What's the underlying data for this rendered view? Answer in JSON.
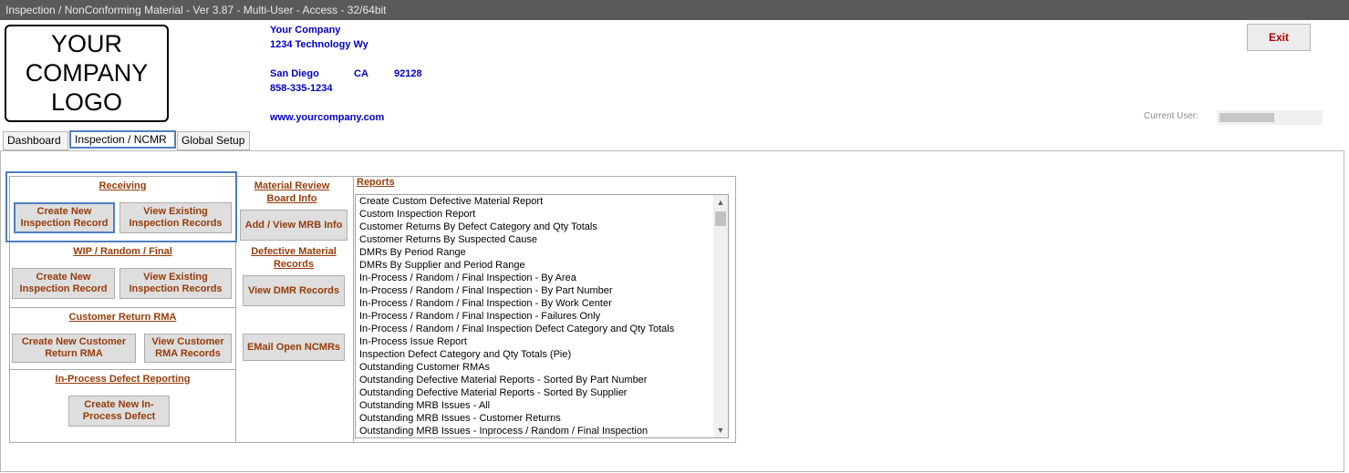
{
  "window": {
    "title": "Inspection / NonConforming Material - Ver 3.87 - Multi-User - Access - 32/64bit"
  },
  "logo": {
    "lines": [
      "YOUR",
      "COMPANY",
      "LOGO"
    ]
  },
  "company": {
    "name": "Your Company",
    "street": "1234 Technology Wy",
    "city": "San Diego",
    "state": "CA",
    "zip": "92128",
    "phone": "858-335-1234",
    "website": "www.yourcompany.com"
  },
  "exit_label": "Exit",
  "current_user": {
    "label": "Current User:",
    "value": ""
  },
  "tabs": [
    {
      "label": "Dashboard",
      "active": false
    },
    {
      "label": "Inspection / NCMR",
      "active": true
    },
    {
      "label": "Global Setup",
      "active": false
    }
  ],
  "receiving": {
    "title": "Receiving",
    "create_label": "Create New Inspection Record",
    "view_label": "View Existing Inspection Records"
  },
  "wip": {
    "title": "WIP / Random / Final",
    "create_label": "Create New Inspection Record",
    "view_label": "View Existing Inspection Records"
  },
  "rma": {
    "title": "Customer Return RMA",
    "create_label": "Create New Customer Return RMA",
    "view_label": "View Customer RMA Records"
  },
  "inprocess": {
    "title": "In-Process Defect Reporting",
    "create_label": "Create New In-Process Defect"
  },
  "mrb": {
    "title": "Material Review Board Info",
    "button_label": "Add / View MRB Info"
  },
  "defective": {
    "title": "Defective Material Records",
    "view_label": "View DMR Records",
    "email_label": "EMail Open NCMRs"
  },
  "reports": {
    "title": "Reports",
    "items": [
      "Create Custom Defective Material Report",
      "Custom Inspection Report",
      "Customer Returns By Defect Category and Qty Totals",
      "Customer Returns By Suspected Cause",
      "DMRs By Period Range",
      "DMRs By Supplier and Period Range",
      "In-Process / Random / Final Inspection - By Area",
      "In-Process / Random / Final Inspection - By Part Number",
      "In-Process / Random / Final Inspection - By Work Center",
      "In-Process / Random / Final Inspection - Failures Only",
      "In-Process / Random / Final Inspection Defect Category and Qty Totals",
      "In-Process Issue Report",
      "Inspection Defect Category and Qty Totals (Pie)",
      "Outstanding Customer RMAs",
      "Outstanding Defective Material Reports - Sorted By Part Number",
      "Outstanding Defective Material Reports - Sorted By Supplier",
      "Outstanding MRB Issues - All",
      "Outstanding MRB Issues - Customer Returns",
      "Outstanding MRB Issues - Inprocess / Random / Final Inspection"
    ]
  }
}
